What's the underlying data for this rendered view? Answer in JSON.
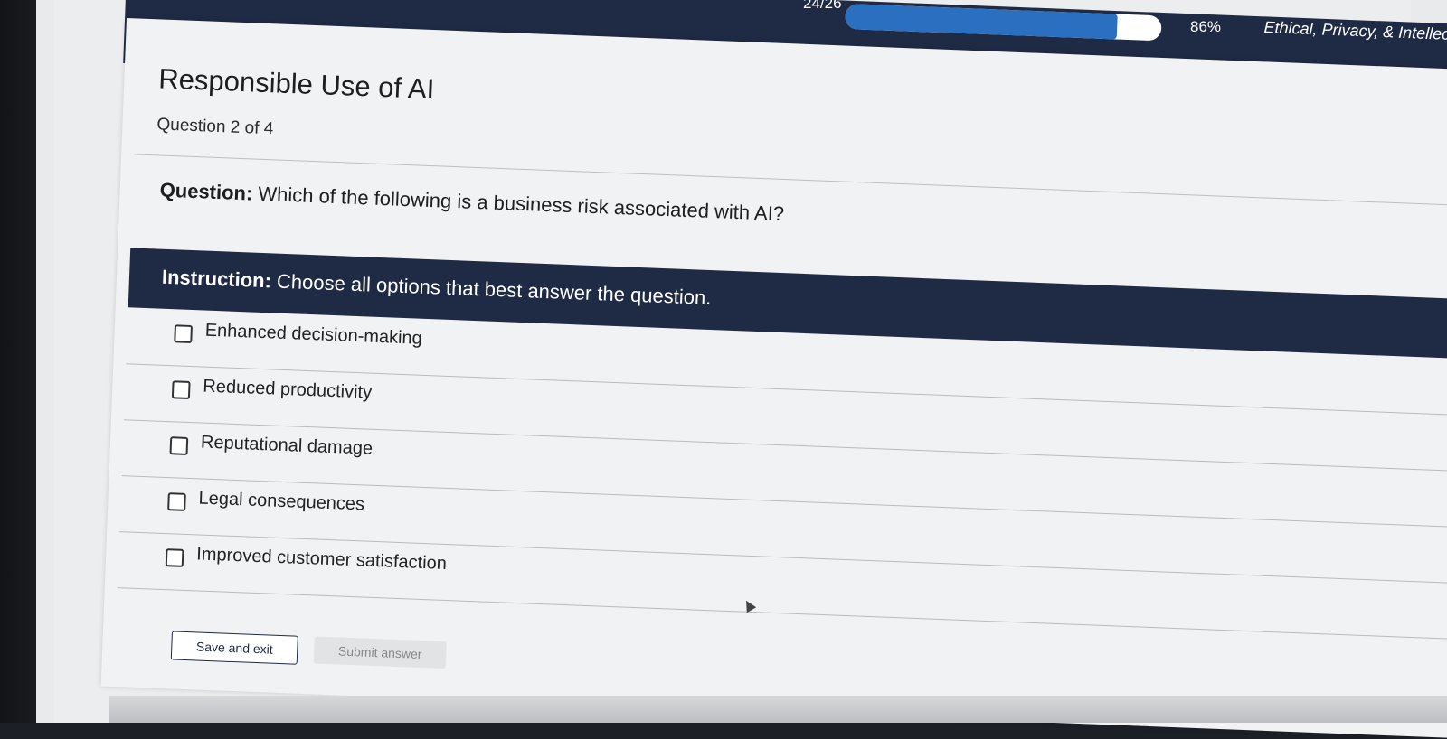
{
  "header": {
    "progress_count": "24/26",
    "progress_value": 0.86,
    "progress_percent": "86%",
    "course_title": "Ethical, Privacy, & Intellec"
  },
  "quiz": {
    "title": "Responsible Use of AI",
    "question_count": "Question 2 of 4",
    "question_label": "Question:",
    "question_text": " Which of the following is a business risk associated with AI?",
    "instruction_label": "Instruction:",
    "instruction_text": " Choose all options that best answer the question.",
    "options": [
      {
        "label": "Enhanced decision-making",
        "checked": false
      },
      {
        "label": "Reduced productivity",
        "checked": false
      },
      {
        "label": "Reputational damage",
        "checked": false
      },
      {
        "label": "Legal consequences",
        "checked": false
      },
      {
        "label": "Improved customer satisfaction",
        "checked": false
      }
    ]
  },
  "actions": {
    "save_label": "Save and exit",
    "submit_label": "Submit answer"
  },
  "colors": {
    "header_bg": "#1f2a44",
    "progress_fill": "#2a6fc0",
    "card_bg": "#f1f2f3"
  }
}
